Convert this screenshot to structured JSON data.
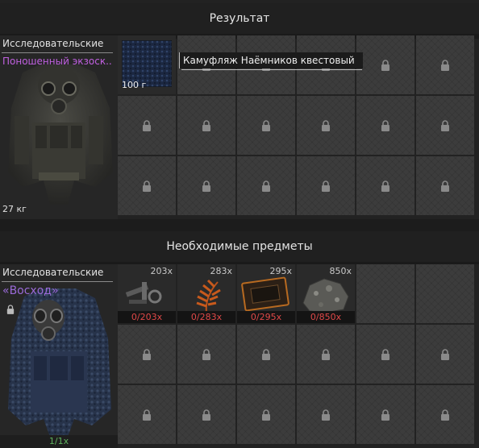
{
  "result": {
    "header": "Результат",
    "category": "Исследовательские",
    "item_name": "Поношенный экзоск..",
    "item_color": "#c060e0",
    "weight": "27 кг"
  },
  "result_grid": {
    "first_cell_amount": "100 г",
    "tooltip": "Камуфляж Наёмников квестовый"
  },
  "required": {
    "header": "Необходимые предметы",
    "category": "Исследовательские",
    "item_name": "«Восход»",
    "item_color": "#9a6ad8",
    "craft_count": "1/1x",
    "items": [
      {
        "qty": "203x",
        "need": "0/203x",
        "icon": "scrap-parts-icon"
      },
      {
        "qty": "283x",
        "need": "0/283x",
        "icon": "fern-icon"
      },
      {
        "qty": "295x",
        "need": "0/295x",
        "icon": "circuit-board-icon"
      },
      {
        "qty": "850x",
        "need": "0/850x",
        "icon": "rock-ore-icon"
      }
    ]
  }
}
